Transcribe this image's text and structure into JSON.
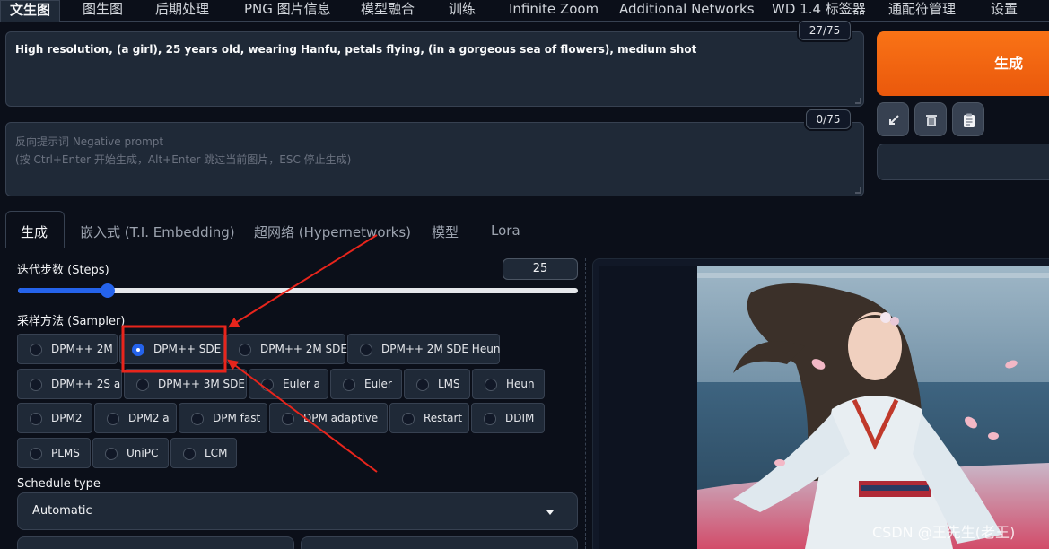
{
  "top_tabs": [
    {
      "label": "文生图",
      "active": true
    },
    {
      "label": "图生图"
    },
    {
      "label": "后期处理"
    },
    {
      "label": "PNG 图片信息"
    },
    {
      "label": "模型融合"
    },
    {
      "label": "训练"
    },
    {
      "label": "Infinite Zoom"
    },
    {
      "label": "Additional Networks"
    },
    {
      "label": "WD 1.4 标签器"
    },
    {
      "label": "通配符管理"
    },
    {
      "label": "设置"
    }
  ],
  "prompt": {
    "text": "High resolution, (a girl), 25 years old, wearing Hanfu, petals flying, (in a gorgeous sea of flowers), medium shot",
    "counter": "27/75"
  },
  "negative_prompt": {
    "placeholder_line1": "反向提示词 Negative prompt",
    "placeholder_line2": "(按 Ctrl+Enter 开始生成，Alt+Enter 跳过当前图片，ESC 停止生成)",
    "counter": "0/75"
  },
  "generate_label": "生成",
  "tools": [
    {
      "icon": "arrow-icon"
    },
    {
      "icon": "trash-icon"
    },
    {
      "icon": "clipboard-icon"
    }
  ],
  "gen_tabs": [
    {
      "label": "生成",
      "active": true
    },
    {
      "label": "嵌入式 (T.I. Embedding)"
    },
    {
      "label": "超网络 (Hypernetworks)"
    },
    {
      "label": "模型"
    },
    {
      "label": "Lora"
    }
  ],
  "steps": {
    "label": "迭代步数 (Steps)",
    "value": "25",
    "fraction": 0.16
  },
  "sampler": {
    "label": "采样方法 (Sampler)",
    "selected": "DPM++ SDE",
    "options": [
      "DPM++ 2M",
      "DPM++ SDE",
      "DPM++ 2M SDE",
      "DPM++ 2M SDE Heun",
      "DPM++ 2S a",
      "DPM++ 3M SDE",
      "Euler a",
      "Euler",
      "LMS",
      "Heun",
      "DPM2",
      "DPM2 a",
      "DPM fast",
      "DPM adaptive",
      "Restart",
      "DDIM",
      "PLMS",
      "UniPC",
      "LCM"
    ]
  },
  "schedule": {
    "label": "Schedule type",
    "value": "Automatic"
  },
  "watermark": "CSDN @王先生(老王)",
  "colors": {
    "accent": "#2563eb",
    "generate": "#f97316",
    "highlight": "#e8251c"
  }
}
